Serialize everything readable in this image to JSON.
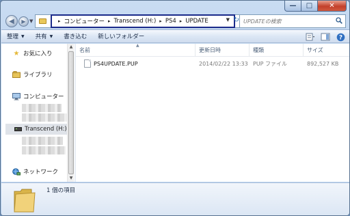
{
  "window": {
    "minimize_glyph": "—",
    "maximize_glyph": "□",
    "close_glyph": "✕"
  },
  "address": {
    "breadcrumbs": [
      "コンピューター",
      "Transcend (H:)",
      "PS4",
      "UPDATE"
    ],
    "separator": "▸"
  },
  "search": {
    "placeholder": "UPDATEの検索"
  },
  "toolbar": {
    "organize": "整理",
    "share": "共有",
    "burn": "書き込む",
    "new_folder": "新しいフォルダー"
  },
  "sidebar": {
    "favorites": "お気に入り",
    "libraries": "ライブラリ",
    "computer": "コンピューター",
    "drive": "Transcend (H:)",
    "network": "ネットワーク"
  },
  "columns": {
    "name": "名前",
    "date": "更新日時",
    "type": "種類",
    "size": "サイズ"
  },
  "files": [
    {
      "name": "PS4UPDATE.PUP",
      "date": "2014/02/22 13:33",
      "type": "PUP ファイル",
      "size": "892,527 KB"
    }
  ],
  "status": {
    "item_count": "1 個の項目"
  },
  "icons": {
    "back": "back-arrow-icon",
    "forward": "forward-arrow-icon",
    "search": "search-icon",
    "refresh": "refresh-icon",
    "favorites": "star-icon",
    "libraries": "library-icon",
    "computer": "computer-icon",
    "drive": "usb-drive-icon",
    "network": "network-icon"
  },
  "colors": {
    "breadcrumb_highlight": "#1a2a8a",
    "close_button": "#c3402b"
  }
}
